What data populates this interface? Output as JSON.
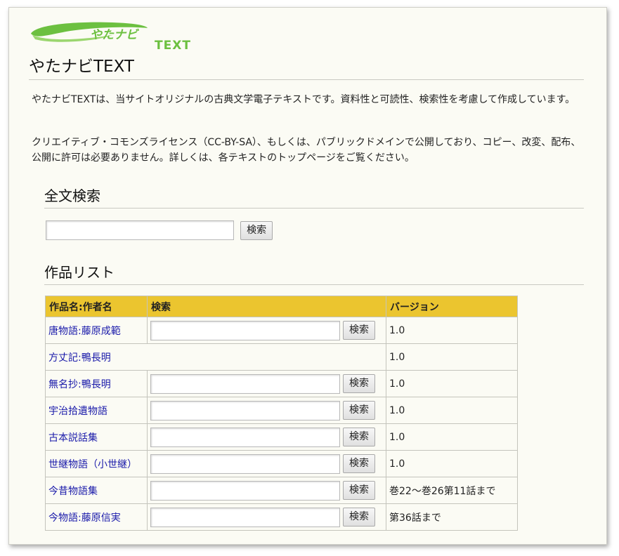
{
  "logo": {
    "text": "TEXT",
    "brand_color": "#6cc040",
    "icon_name": "yatanavi-logo"
  },
  "site_title": "やたナビTEXT",
  "intro": {
    "p1": "やたナビTEXTは、当サイトオリジナルの古典文学電子テキストです。資料性と可読性、検索性を考慮して作成しています。",
    "p2": "クリエイティブ・コモンズライセンス（CC-BY-SA）、もしくは、パブリックドメインで公開しており、コピー、改変、配布、公開に許可は必要ありません。詳しくは、各テキストのトップページをご覧ください。"
  },
  "fulltext_search": {
    "heading": "全文検索",
    "input_value": "",
    "button_label": "検索"
  },
  "works": {
    "heading": "作品リスト",
    "header_color": "#ebc52f",
    "columns": [
      "作品名:作者名",
      "検索",
      "バージョン"
    ],
    "button_label": "検索",
    "rows": [
      {
        "title": "唐物語:藤原成範",
        "has_search": true,
        "version": "1.0"
      },
      {
        "title": "方丈記:鴨長明",
        "has_search": false,
        "version": "1.0"
      },
      {
        "title": "無名抄:鴨長明",
        "has_search": true,
        "version": "1.0"
      },
      {
        "title": "宇治拾遺物語",
        "has_search": true,
        "version": "1.0"
      },
      {
        "title": "古本説話集",
        "has_search": true,
        "version": "1.0"
      },
      {
        "title": "世継物語（小世継）",
        "has_search": true,
        "version": "1.0"
      },
      {
        "title": "今昔物語集",
        "has_search": true,
        "version": "巻22〜巻26第11話まで"
      },
      {
        "title": "今物語:藤原信実",
        "has_search": true,
        "version": "第36話まで"
      }
    ]
  }
}
